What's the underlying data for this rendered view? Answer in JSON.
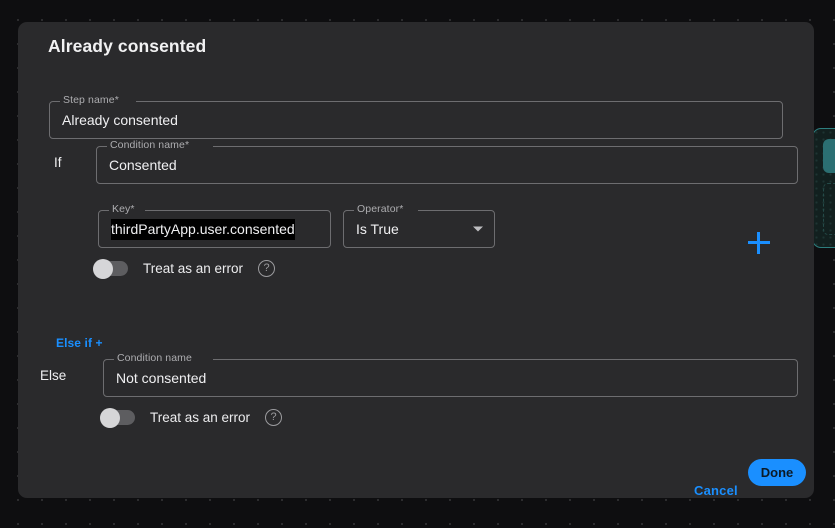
{
  "dialog": {
    "title": "Already consented",
    "step_name_field": {
      "label": "Step name",
      "required_mark": "*",
      "value": "Already consented"
    },
    "if_branch": {
      "side_label": "If",
      "condition_name_field": {
        "label": "Condition name",
        "required_mark": "*",
        "value": "Consented"
      },
      "key_field": {
        "label": "Key",
        "required_mark": "*",
        "value": "thirdPartyApp.user.consented"
      },
      "operator_field": {
        "label": "Operator",
        "required_mark": "*",
        "value": "Is True"
      },
      "add_icon": "plus-icon",
      "treat_as_error": {
        "label": "Treat as an error",
        "state": "off",
        "help_icon": "question-mark-icon"
      }
    },
    "else_if_link": "Else if +",
    "else_branch": {
      "side_label": "Else",
      "condition_name_field": {
        "label": "Condition name",
        "required_mark": "",
        "value": "Not consented"
      },
      "treat_as_error": {
        "label": "Treat as an error",
        "state": "off",
        "help_icon": "question-mark-icon"
      }
    },
    "footer": {
      "cancel_label": "Cancel",
      "done_label": "Done"
    }
  },
  "colors": {
    "accent_blue": "#1a8fff",
    "dialog_bg": "#2a2a2c",
    "canvas_bg": "#0e0e10",
    "node_teal": "#2d7e7e",
    "field_outline": "#6d6d70"
  }
}
